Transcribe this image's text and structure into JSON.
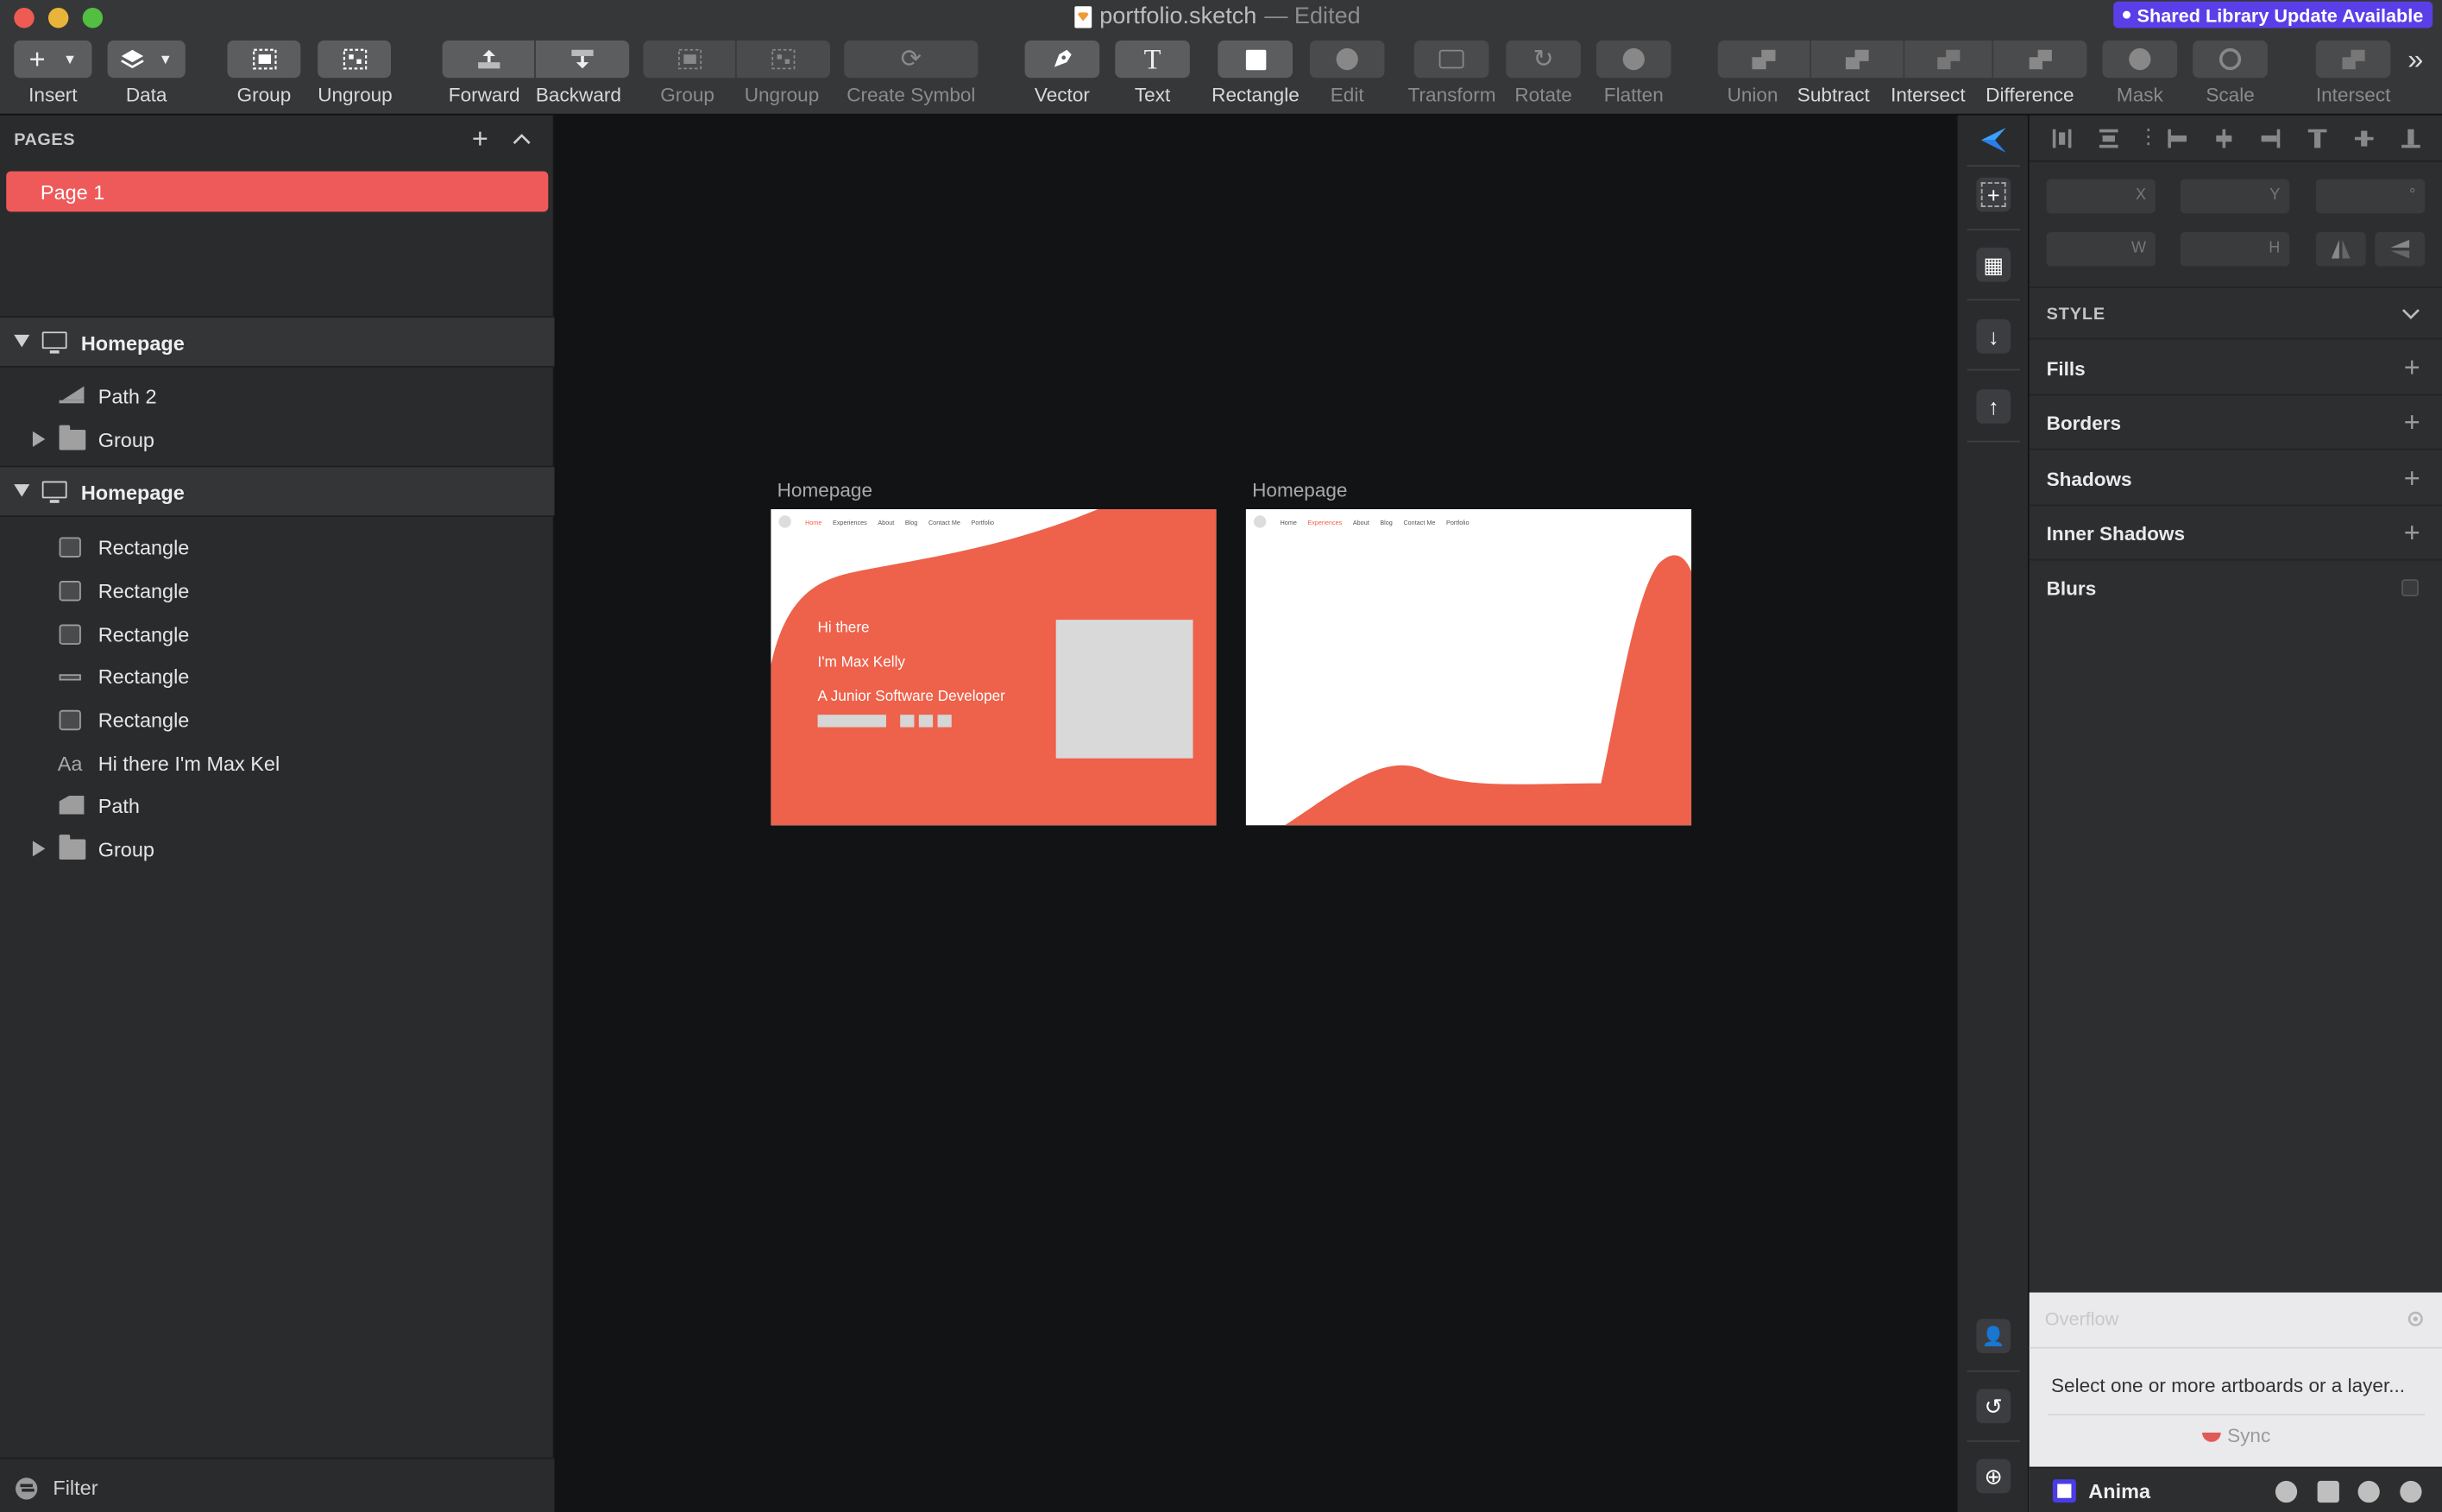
{
  "window": {
    "title": "portfolio.sketch",
    "title_suffix": " — Edited",
    "shared_badge": "Shared Library Update Available",
    "accent": "#5a3fe8"
  },
  "toolbar": {
    "insert": "Insert",
    "data": "Data",
    "group": "Group",
    "ungroup": "Ungroup",
    "forward": "Forward",
    "backward": "Backward",
    "group2": "Group",
    "ungroup2": "Ungroup",
    "create_symbol": "Create Symbol",
    "vector": "Vector",
    "text": "Text",
    "rectangle": "Rectangle",
    "edit": "Edit",
    "transform": "Transform",
    "rotate": "Rotate",
    "flatten": "Flatten",
    "union": "Union",
    "subtract": "Subtract",
    "intersect": "Intersect",
    "difference": "Difference",
    "mask": "Mask",
    "scale": "Scale",
    "intersect2": "Intersect"
  },
  "pages": {
    "heading": "PAGES",
    "items": [
      {
        "label": "Page 1",
        "selected": true
      }
    ]
  },
  "layers": {
    "artboards": [
      {
        "name": "Homepage",
        "children": [
          {
            "name": "Path 2",
            "icon": "path-icon"
          },
          {
            "name": "Group",
            "icon": "folder-icon"
          }
        ]
      },
      {
        "name": "Homepage",
        "children": [
          {
            "name": "Rectangle",
            "icon": "rectangle-icon"
          },
          {
            "name": "Rectangle",
            "icon": "rectangle-icon"
          },
          {
            "name": "Rectangle",
            "icon": "rectangle-icon"
          },
          {
            "name": "Rectangle",
            "icon": "line-icon"
          },
          {
            "name": "Rectangle",
            "icon": "rectangle-icon"
          },
          {
            "name": "Hi there I'm Max Kel",
            "icon": "text-icon"
          },
          {
            "name": "Path",
            "icon": "path-icon"
          },
          {
            "name": "Group",
            "icon": "folder-icon"
          }
        ]
      }
    ],
    "filter_label": "Filter"
  },
  "canvas": {
    "artboard1": {
      "title": "Homepage",
      "nav": [
        "Home",
        "Experiences",
        "About",
        "Blog",
        "Contact Me",
        "Portfolio"
      ],
      "active_nav": "Home",
      "hero": [
        "Hi there",
        "I'm Max Kelly",
        "A Junior Software Developer"
      ],
      "accent": "#ee614a"
    },
    "artboard2": {
      "title": "Homepage",
      "nav": [
        "Home",
        "Experiences",
        "About",
        "Blog",
        "Contact Me",
        "Portfolio"
      ],
      "active_nav": "Experiences",
      "accent": "#ee614a"
    }
  },
  "inspector": {
    "x_label": "X",
    "y_label": "Y",
    "rot_label": "°",
    "w_label": "W",
    "h_label": "H",
    "style_heading": "STYLE",
    "sections": [
      "Fills",
      "Borders",
      "Shadows",
      "Inner Shadows",
      "Blurs"
    ]
  },
  "anima": {
    "overflow": "Overflow",
    "message": "Select one or more artboards or a layer...",
    "sync": "Sync",
    "brand": "Anima"
  }
}
